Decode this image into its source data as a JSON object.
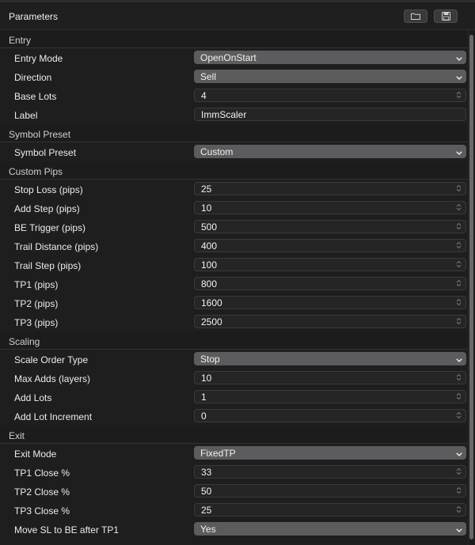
{
  "header": {
    "title": "Parameters"
  },
  "sections": [
    {
      "title": "Entry",
      "rows": [
        {
          "label": "Entry Mode",
          "type": "select",
          "value": "OpenOnStart"
        },
        {
          "label": "Direction",
          "type": "select",
          "value": "Sell"
        },
        {
          "label": "Base Lots",
          "type": "number",
          "value": "4"
        },
        {
          "label": "Label",
          "type": "text",
          "value": "ImmScaler"
        }
      ]
    },
    {
      "title": "Symbol Preset",
      "rows": [
        {
          "label": "Symbol Preset",
          "type": "select",
          "value": "Custom"
        }
      ]
    },
    {
      "title": "Custom Pips",
      "rows": [
        {
          "label": "Stop Loss (pips)",
          "type": "number",
          "value": "25"
        },
        {
          "label": "Add Step (pips)",
          "type": "number",
          "value": "10"
        },
        {
          "label": "BE Trigger (pips)",
          "type": "number",
          "value": "500"
        },
        {
          "label": "Trail Distance (pips)",
          "type": "number",
          "value": "400"
        },
        {
          "label": "Trail Step (pips)",
          "type": "number",
          "value": "100"
        },
        {
          "label": "TP1 (pips)",
          "type": "number",
          "value": "800"
        },
        {
          "label": "TP2 (pips)",
          "type": "number",
          "value": "1600"
        },
        {
          "label": "TP3 (pips)",
          "type": "number",
          "value": "2500"
        }
      ]
    },
    {
      "title": "Scaling",
      "rows": [
        {
          "label": "Scale Order Type",
          "type": "select",
          "value": "Stop"
        },
        {
          "label": "Max Adds (layers)",
          "type": "number",
          "value": "10"
        },
        {
          "label": "Add Lots",
          "type": "number",
          "value": "1"
        },
        {
          "label": "Add Lot Increment",
          "type": "number",
          "value": "0"
        }
      ]
    },
    {
      "title": "Exit",
      "rows": [
        {
          "label": "Exit Mode",
          "type": "select",
          "value": "FixedTP"
        },
        {
          "label": "TP1 Close %",
          "type": "number",
          "value": "33"
        },
        {
          "label": "TP2 Close %",
          "type": "number",
          "value": "50"
        },
        {
          "label": "TP3 Close %",
          "type": "number",
          "value": "25"
        },
        {
          "label": "Move SL to BE after TP1",
          "type": "select",
          "value": "Yes"
        }
      ]
    }
  ]
}
